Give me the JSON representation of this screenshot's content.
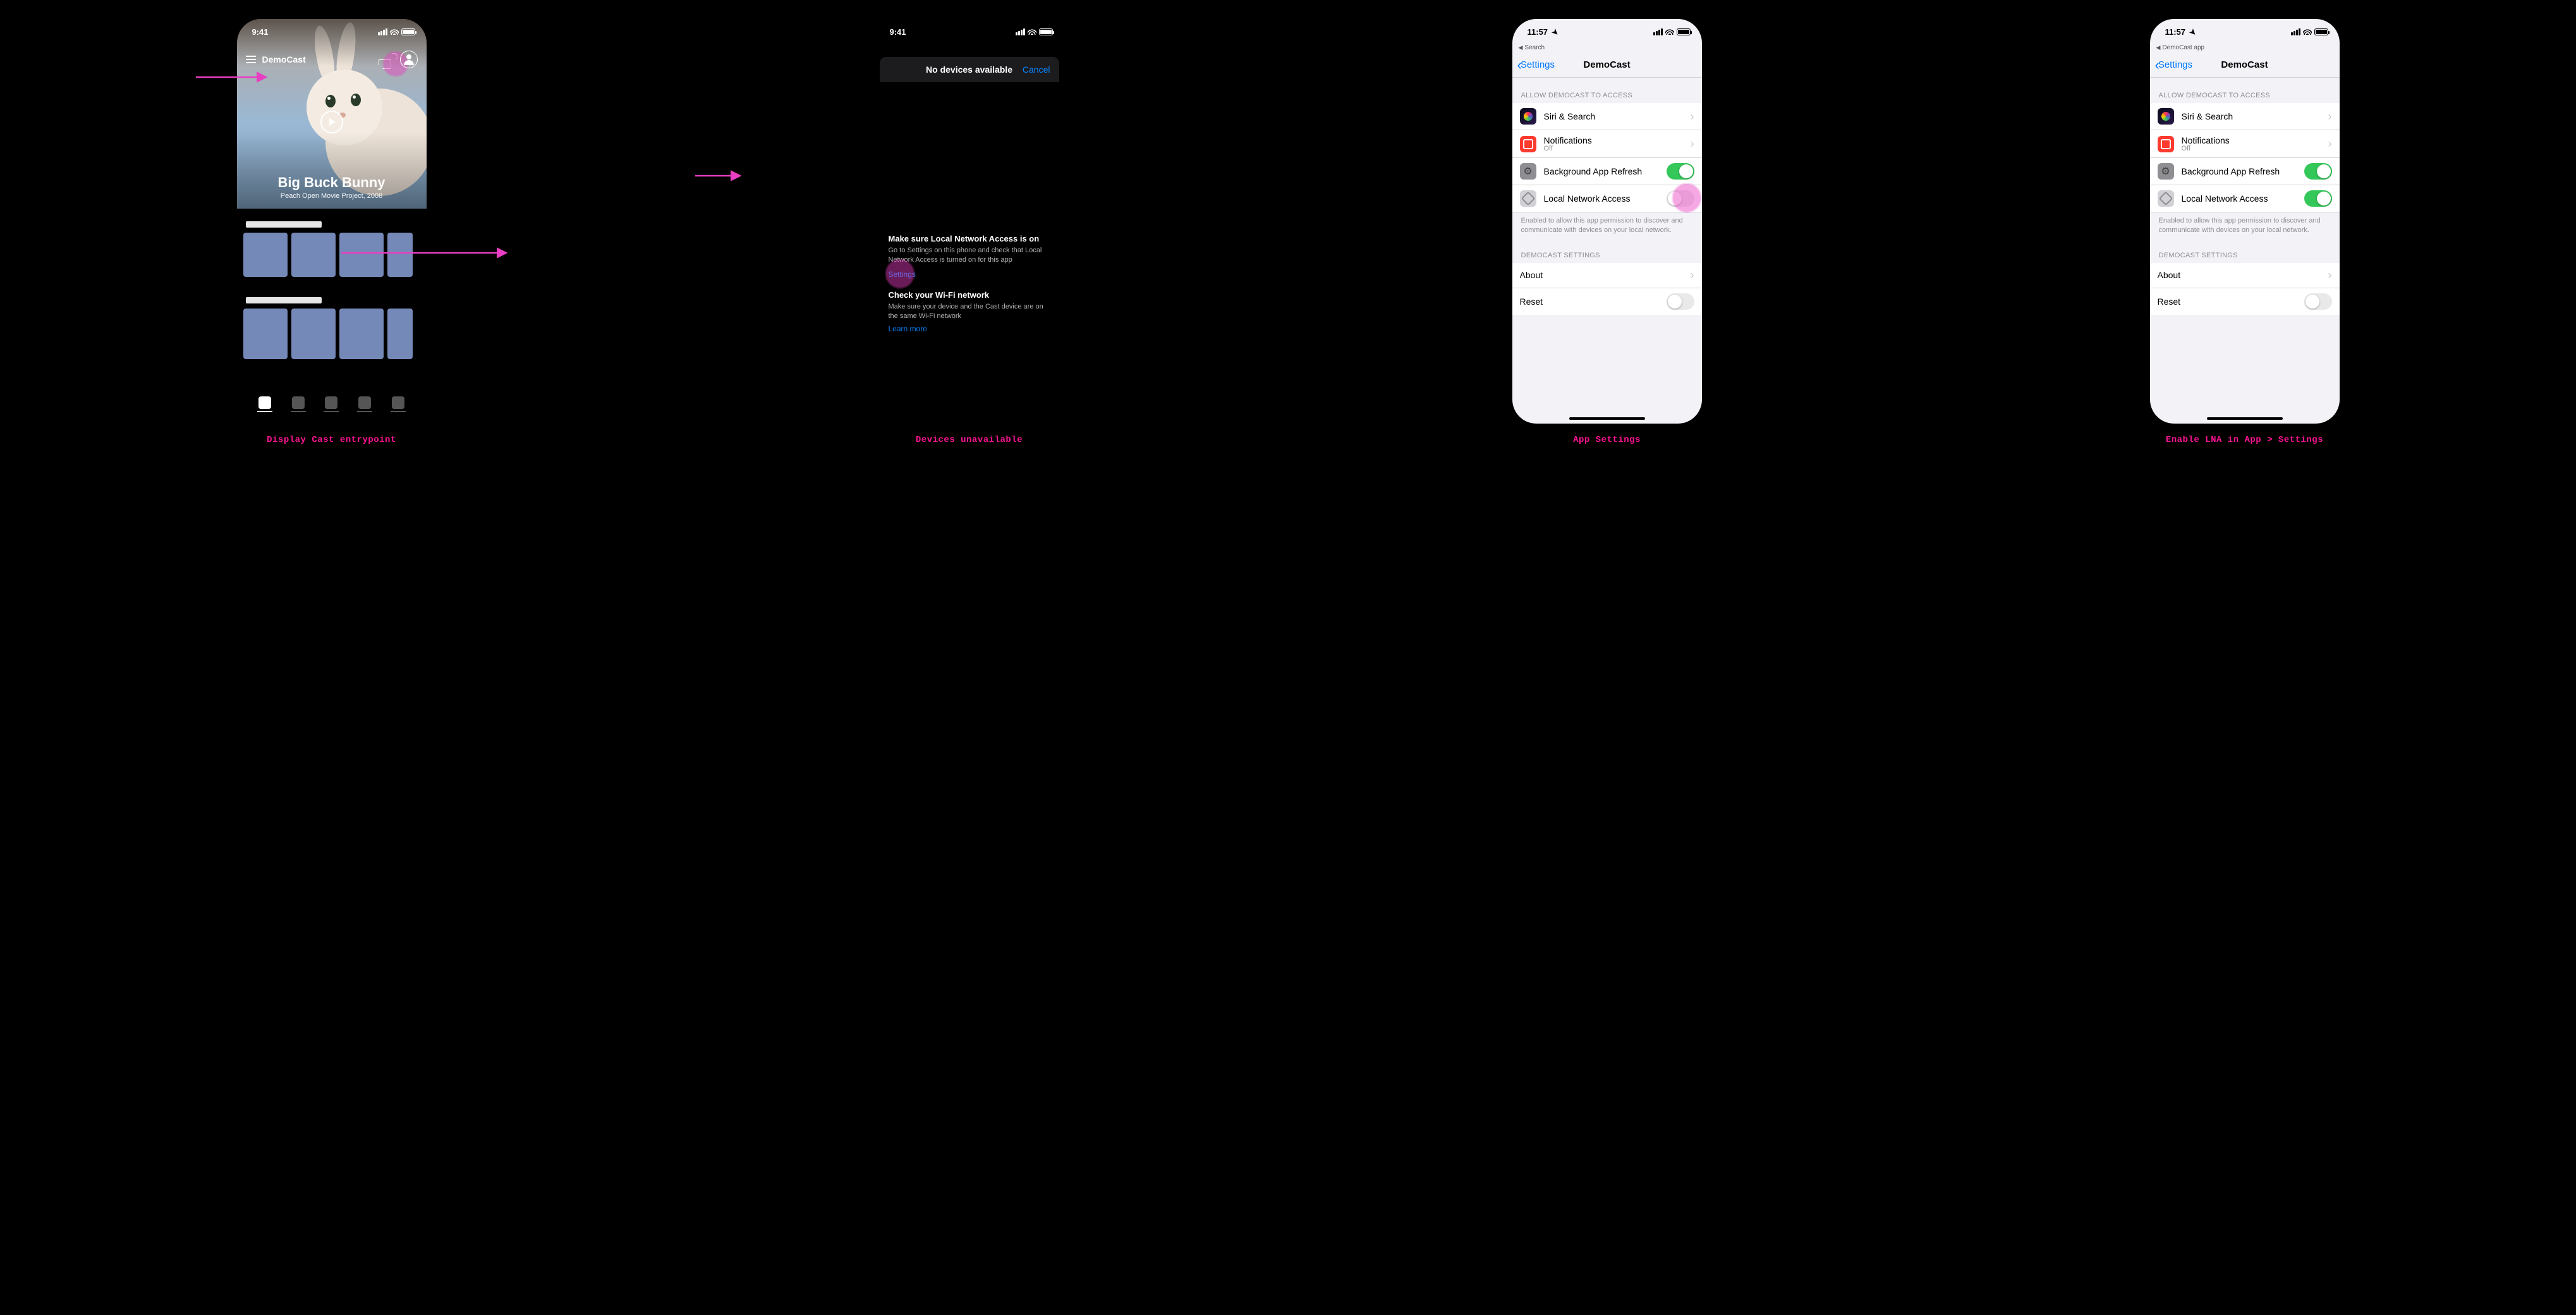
{
  "captions": {
    "p1": "Display Cast entrypoint",
    "p2": "Devices unavailable",
    "p3": "App Settings",
    "p4": "Enable LNA in App > Settings"
  },
  "status": {
    "time_dark": "9:41",
    "time_light": "11:57"
  },
  "breadcrumb": {
    "p3": "Search",
    "p4": "DemoCast app"
  },
  "app": {
    "name": "DemoCast",
    "hero_title": "Big Buck Bunny",
    "hero_sub": "Peach Open Movie Project, 2008"
  },
  "no_devices": {
    "title": "No devices available",
    "cancel": "Cancel",
    "lna_h": "Make sure Local Network Access is on",
    "lna_p": "Go to Settings on this phone and check that Local Network Access is turned on for this app",
    "settings_link": "Settings",
    "wifi_h": "Check your Wi-Fi network",
    "wifi_p": "Make sure your device and the Cast device are on the same Wi-Fi network",
    "learn_more": "Learn more"
  },
  "settings": {
    "back": "Settings",
    "title": "DemoCast",
    "section_access": "ALLOW DEMOCAST TO ACCESS",
    "siri": "Siri & Search",
    "notif": "Notifications",
    "notif_sub": "Off",
    "bg_refresh": "Background App Refresh",
    "lna": "Local Network Access",
    "lna_footer": "Enabled to allow this app permission to discover and communicate with devices on your local network.",
    "section_app": "DEMOCAST SETTINGS",
    "about": "About",
    "reset": "Reset"
  },
  "switches": {
    "p3_bg": true,
    "p3_lna": false,
    "p3_reset": false,
    "p4_bg": true,
    "p4_lna": true,
    "p4_reset": false
  }
}
